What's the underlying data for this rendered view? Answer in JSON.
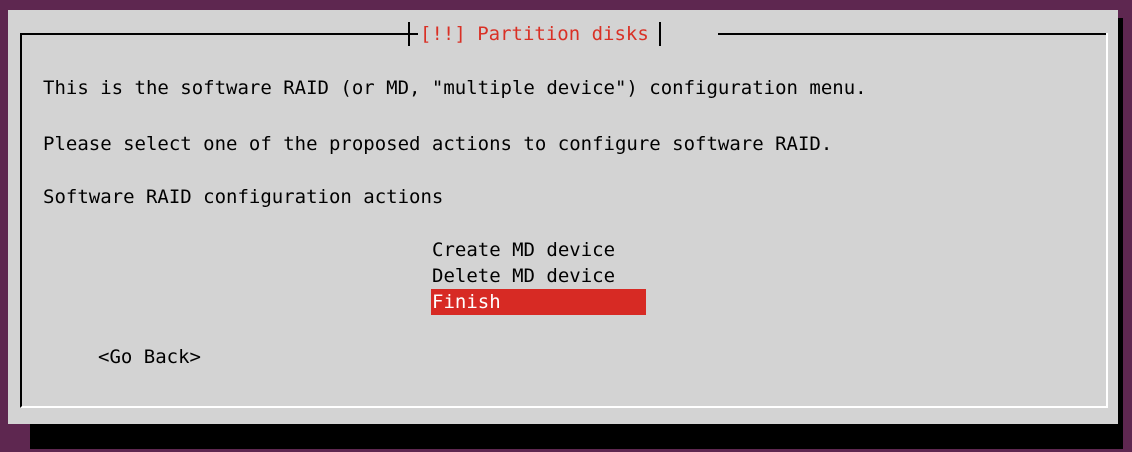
{
  "dialog": {
    "title": "[!!] Partition disks",
    "lines": [
      "This is the software RAID (or MD, \"multiple device\") configuration menu.",
      "Please select one of the proposed actions to configure software RAID.",
      "Software RAID configuration actions"
    ],
    "menu": {
      "items": [
        {
          "label": "Create MD device",
          "selected": false
        },
        {
          "label": "Delete MD device",
          "selected": false
        },
        {
          "label": "Finish",
          "selected": true
        }
      ]
    },
    "go_back_label": "<Go Back>"
  },
  "colors": {
    "background": "#5e2750",
    "dialog": "#d3d3d3",
    "title": "#d93025",
    "selection": "#d72a24"
  }
}
